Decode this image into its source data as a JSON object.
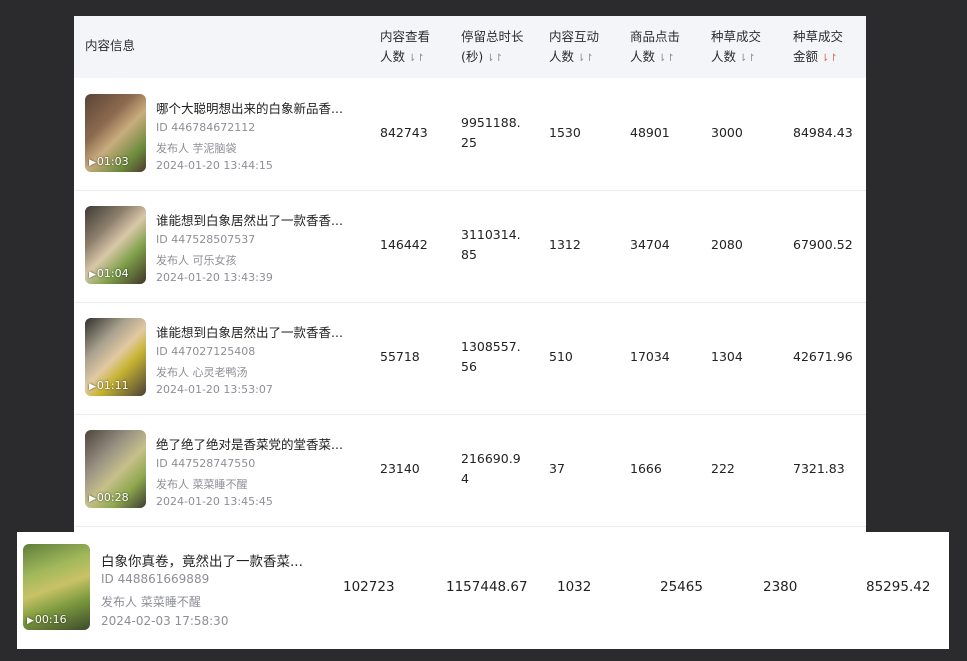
{
  "headers": {
    "content_info": "内容信息",
    "views_1": "内容查看",
    "views_2": "人数",
    "dwell_1": "停留总时长",
    "dwell_2": "(秒)",
    "interact_1": "内容互动",
    "interact_2": "人数",
    "clicks_1": "商品点击",
    "clicks_2": "人数",
    "buyers_1": "种草成交",
    "buyers_2": "人数",
    "amount_1": "种草成交",
    "amount_2": "金额",
    "sort_icon": "⇂↾"
  },
  "rows": [
    {
      "title": "哪个大聪明想出来的白象新品香...",
      "id": "ID 446784672112",
      "publisher": "发布人  芋泥脑袋",
      "time": "2024-01-20 13:44:15",
      "duration": "01:03",
      "views": "842743",
      "dwell_1": "9951188.",
      "dwell_2": "25",
      "interactions": "1530",
      "clicks": "48901",
      "buyers": "3000",
      "amount": "84984.43"
    },
    {
      "title": "谁能想到白象居然出了一款香香...",
      "id": "ID 447528507537",
      "publisher": "发布人  可乐女孩",
      "time": "2024-01-20 13:43:39",
      "duration": "01:04",
      "views": "146442",
      "dwell_1": "3110314.",
      "dwell_2": "85",
      "interactions": "1312",
      "clicks": "34704",
      "buyers": "2080",
      "amount": "67900.52"
    },
    {
      "title": "谁能想到白象居然出了一款香香...",
      "id": "ID 447027125408",
      "publisher": "发布人  心灵老鸭汤",
      "time": "2024-01-20 13:53:07",
      "duration": "01:11",
      "views": "55718",
      "dwell_1": "1308557.",
      "dwell_2": "56",
      "interactions": "510",
      "clicks": "17034",
      "buyers": "1304",
      "amount": "42671.96"
    },
    {
      "title": "绝了绝了绝对是香菜党的堂香菜...",
      "id": "ID 447528747550",
      "publisher": "发布人  菜菜睡不醒",
      "time": "2024-01-20 13:45:45",
      "duration": "00:28",
      "views": "23140",
      "dwell_1": "216690.9",
      "dwell_2": "4",
      "interactions": "37",
      "clicks": "1666",
      "buyers": "222",
      "amount": "7321.83"
    }
  ],
  "highlight": {
    "title": "白象你真卷，竟然出了一款香菜...",
    "id": "ID 448861669889",
    "publisher": "发布人  菜菜睡不醒",
    "time": "2024-02-03 17:58:30",
    "duration": "00:16",
    "views": "102723",
    "dwell": "1157448.67",
    "interactions": "1032",
    "clicks": "25465",
    "buyers": "2380",
    "amount": "85295.42"
  }
}
